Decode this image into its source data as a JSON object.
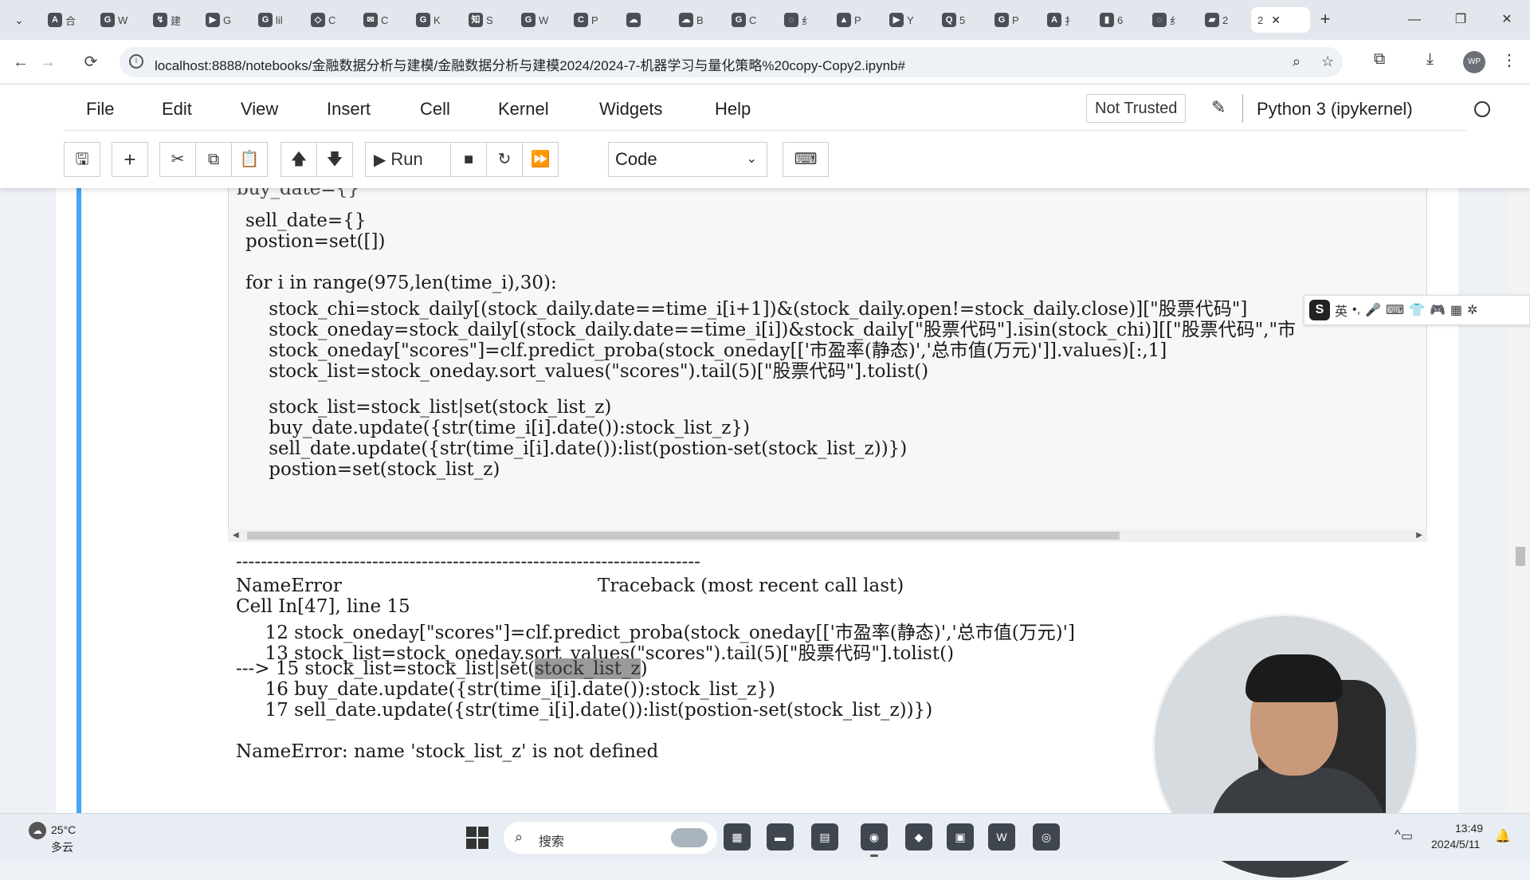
{
  "browser": {
    "tab_menu_icon": "chevron-down-icon",
    "tabs": [
      {
        "label": "合",
        "icon": "A"
      },
      {
        "label": "W",
        "icon": "G"
      },
      {
        "label": "建",
        "icon": "↯"
      },
      {
        "label": "G",
        "icon": "▶"
      },
      {
        "label": "lil",
        "icon": "G"
      },
      {
        "label": "C",
        "icon": "◇"
      },
      {
        "label": "C",
        "icon": "✉"
      },
      {
        "label": "K",
        "icon": "G"
      },
      {
        "label": "S",
        "icon": "知"
      },
      {
        "label": "W",
        "icon": "G"
      },
      {
        "label": "P",
        "icon": "C"
      },
      {
        "label": "",
        "icon": "☁"
      },
      {
        "label": "B",
        "icon": "☁"
      },
      {
        "label": "C",
        "icon": "G"
      },
      {
        "label": "纟",
        "icon": "◌"
      },
      {
        "label": "P",
        "icon": "▲"
      },
      {
        "label": "Y",
        "icon": "▶"
      },
      {
        "label": "5",
        "icon": "Q"
      },
      {
        "label": "P",
        "icon": "G"
      },
      {
        "label": "扌",
        "icon": "A"
      },
      {
        "label": "6",
        "icon": "▮"
      },
      {
        "label": "纟",
        "icon": "◌"
      },
      {
        "label": "2",
        "icon": "▰"
      }
    ],
    "active_tab": {
      "label": "2",
      "close": "✕"
    },
    "new_tab_label": "+",
    "window_controls": [
      "—",
      "❐",
      "✕"
    ],
    "url": "localhost:8888/notebooks/金融数据分析与建模/金融数据分析与建模2024/2024-7-机器学习与量化策略%20copy-Copy2.ipynb#",
    "profile_initials": "WP"
  },
  "jupyter": {
    "menu": [
      "File",
      "Edit",
      "View",
      "Insert",
      "Cell",
      "Kernel",
      "Widgets",
      "Help"
    ],
    "not_trusted": "Not Trusted",
    "kernel": "Python 3 (ipykernel)",
    "run_label": "Run",
    "cell_type": "Code"
  },
  "code_lines": [
    "sell_date={}",
    "postion=set([])",
    "",
    "for i in range(975,len(time_i),30):",
    "    stock_chi=stock_daily[(stock_daily.date==time_i[i+1])&(stock_daily.open!=stock_daily.close)][\"股票代码\"]",
    "    stock_oneday=stock_daily[(stock_daily.date==time_i[i])&stock_daily[\"股票代码\"].isin(stock_chi)][[\"股票代码\",\"市",
    "    stock_oneday[\"scores\"]=clf.predict_proba(stock_oneday[['市盈率(静态)','总市值(万元)']].values)[:,1]",
    "    stock_list=stock_oneday.sort_values(\"scores\").tail(5)[\"股票代码\"].tolist()",
    "",
    "    stock_list=stock_list|set(stock_list_z)",
    "    buy_date.update({str(time_i[i].date()):stock_list_z})",
    "    sell_date.update({str(time_i[i].date()):list(postion-set(stock_list_z))})",
    "    postion=set(stock_list_z)"
  ],
  "output": {
    "separator": "---------------------------------------------------------------------------",
    "error_name": "NameError",
    "traceback_title": "Traceback (most recent call last)",
    "cell_ref": "Cell In[47], line 15",
    "trace_lines": [
      {
        "prefix": "     12",
        "text": " stock_oneday[\"scores\"]=clf.predict_proba(stock_oneday[['市盈率(静态)','总市值(万元)']"
      },
      {
        "prefix": "     13",
        "text": " stock_list=stock_oneday.sort_values(\"scores\").tail(5)[\"股票代码\"].tolist()"
      },
      {
        "prefix": "---> 15",
        "text": " stock_list=stock_list|set(",
        "highlight": "stock_list_z",
        "after": ")"
      },
      {
        "prefix": "     16",
        "text": " buy_date.update({str(time_i[i].date()):stock_list_z})"
      },
      {
        "prefix": "     17",
        "text": " sell_date.update({str(time_i[i].date()):list(postion-set(stock_list_z))})"
      }
    ],
    "error_message": "NameError: name 'stock_list_z' is not defined"
  },
  "ime": {
    "logo": "S",
    "lang": "英",
    "punct": "•,",
    "icons": [
      "🎤",
      "⌨",
      "👕",
      "🎮",
      "▦",
      "✲"
    ]
  },
  "taskbar": {
    "weather_temp": "25°C",
    "weather_desc": "多云",
    "search_placeholder": "搜索",
    "apps": [
      "▦",
      "▬",
      "▤",
      "◉",
      "◆",
      "▣",
      "W",
      "◎"
    ],
    "time": "13:49",
    "date": "2024/5/11"
  }
}
